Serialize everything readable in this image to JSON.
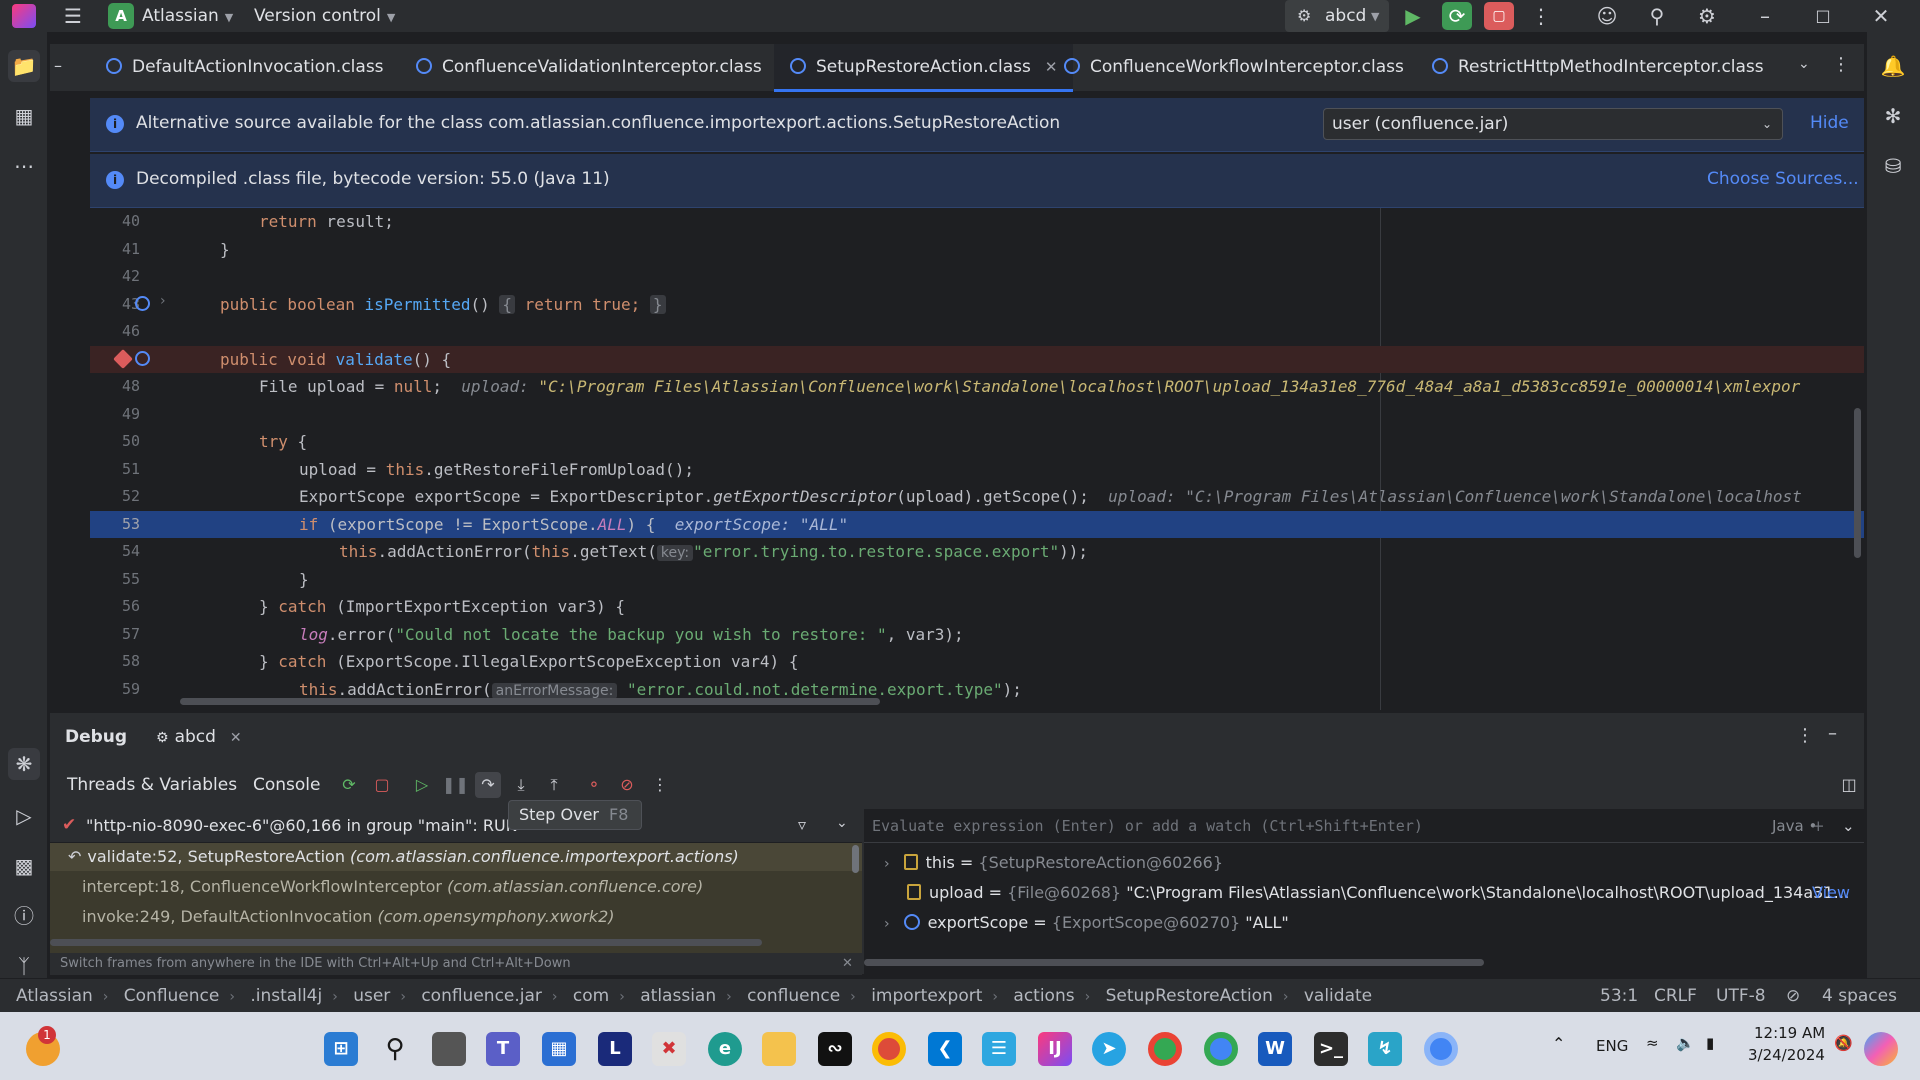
{
  "titlebar": {
    "project_badge": "A",
    "project": "Atlassian",
    "vcs": "Version control",
    "run_config": "abcd"
  },
  "tabs": [
    {
      "label": "DefaultActionInvocation.class"
    },
    {
      "label": "ConfluenceValidationInterceptor.class"
    },
    {
      "label": "SetupRestoreAction.class",
      "active": true
    },
    {
      "label": "ConfluenceWorkflowInterceptor.class"
    },
    {
      "label": "RestrictHttpMethodInterceptor.class"
    }
  ],
  "banner1": {
    "text": "Alternative source available for the class com.atlassian.confluence.importexport.actions.SetupRestoreAction",
    "select_value": "user (confluence.jar)",
    "hide": "Hide"
  },
  "banner2": {
    "text": "Decompiled .class file, bytecode version: 55.0 (Java 11)",
    "choose": "Choose Sources..."
  },
  "code": {
    "l40": {
      "n": "40",
      "a": "return",
      "b": " result;"
    },
    "l41": {
      "n": "41",
      "a": "}"
    },
    "l42": {
      "n": "42"
    },
    "l43": {
      "n": "43",
      "a": "public boolean ",
      "b": "isPermitted",
      "c": "()",
      "d": "{",
      "e": "return true;",
      "f": "}"
    },
    "l46": {
      "n": "46"
    },
    "l47": {
      "a": "public void ",
      "b": "validate",
      "c": "() {"
    },
    "l48": {
      "n": "48",
      "a": "File upload = ",
      "b": "null",
      "c": ";",
      "d": "upload: ",
      "e": "\"C:\\Program Files\\Atlassian\\Confluence\\work\\Standalone\\localhost\\ROOT\\upload_134a31e8_776d_48a4_a8a1_d5383cc8591e_00000014\\xmlexpor"
    },
    "l49": {
      "n": "49"
    },
    "l50": {
      "n": "50",
      "a": "try",
      "b": " {"
    },
    "l51": {
      "n": "51",
      "a": "upload = ",
      "b": "this",
      "c": ".getRestoreFileFromUpload();"
    },
    "l52": {
      "n": "52",
      "a": "ExportScope exportScope = ExportDescriptor.",
      "b": "getExportDescriptor",
      "c": "(upload).getScope();",
      "d": "upload: \"C:\\Program Files\\Atlassian\\Confluence\\work\\Standalone\\localhost"
    },
    "l53": {
      "n": "53",
      "a": "if",
      "b": " (exportScope != ExportScope.",
      "c": "ALL",
      "d": ") {",
      "e": "exportScope: \"ALL\""
    },
    "l54": {
      "n": "54",
      "a": "this",
      "b": ".addActionError(",
      "c": "this",
      "d": ".getText(",
      "e": "key:",
      "f": "\"error.trying.to.restore.space.export\"",
      "g": "));"
    },
    "l55": {
      "n": "55",
      "a": "}"
    },
    "l56": {
      "n": "56",
      "a": "} ",
      "b": "catch",
      "c": " (ImportExportException var3) {"
    },
    "l57": {
      "n": "57",
      "a": "log",
      "b": ".error(",
      "c": "\"Could not locate the backup you wish to restore: \"",
      "d": ", var3);"
    },
    "l58": {
      "n": "58",
      "a": "} ",
      "b": "catch",
      "c": " (ExportScope.IllegalExportScopeException var4) {"
    },
    "l59": {
      "n": "59",
      "a": "this",
      "b": ".addActionError(",
      "c": "anErrorMessage:",
      "d": "\"error.could.not.determine.export.type\"",
      "e": ");"
    }
  },
  "debug": {
    "title": "Debug",
    "session": "abcd",
    "tab_threads": "Threads & Variables",
    "tab_console": "Console",
    "tooltip": "Step Over",
    "tooltip_shortcut": "F8",
    "thread": "\"http-nio-8090-exec-6\"@60,166 in group \"main\": RUN",
    "frames": [
      {
        "loc": "validate:52, SetupRestoreAction ",
        "pkg": "(com.atlassian.confluence.importexport.actions)"
      },
      {
        "loc": "intercept:18, ConfluenceWorkflowInterceptor ",
        "pkg": "(com.atlassian.confluence.core)"
      },
      {
        "loc": "invoke:249, DefaultActionInvocation ",
        "pkg": "(com.opensymphony.xwork2)"
      }
    ],
    "switch_hint": "Switch frames from anywhere in the IDE with Ctrl+Alt+Up and Ctrl+Alt+Down",
    "eval_placeholder": "Evaluate expression (Enter) or add a watch (Ctrl+Shift+Enter)",
    "lang": "Java",
    "vars": [
      {
        "name": "this",
        "eq": " = ",
        "type": "{SetupRestoreAction@60266}",
        "value": ""
      },
      {
        "name": "upload",
        "eq": " = ",
        "type": "{File@60268} ",
        "value": "\"C:\\Program Files\\Atlassian\\Confluence\\work\\Standalone\\localhost\\ROOT\\upload_134a31…",
        "link": "View"
      },
      {
        "name": "exportScope",
        "eq": " = ",
        "type": "{ExportScope@60270} ",
        "value": "\"ALL\""
      }
    ]
  },
  "status": {
    "crumbs": [
      "Atlassian",
      "Confluence",
      ".install4j",
      "user",
      "confluence.jar",
      "com",
      "atlassian",
      "confluence",
      "importexport",
      "actions",
      "SetupRestoreAction",
      "validate"
    ],
    "pos": "53:1",
    "eol": "CRLF",
    "enc": "UTF-8",
    "indent": "4 spaces"
  },
  "taskbar": {
    "lang": "ENG",
    "time": "12:19 AM",
    "date": "3/24/2024",
    "notif_count": "1"
  },
  "colors": {
    "accent": "#3574f0",
    "exec_line": "#214283",
    "breakpoint": "#db5c5c"
  }
}
